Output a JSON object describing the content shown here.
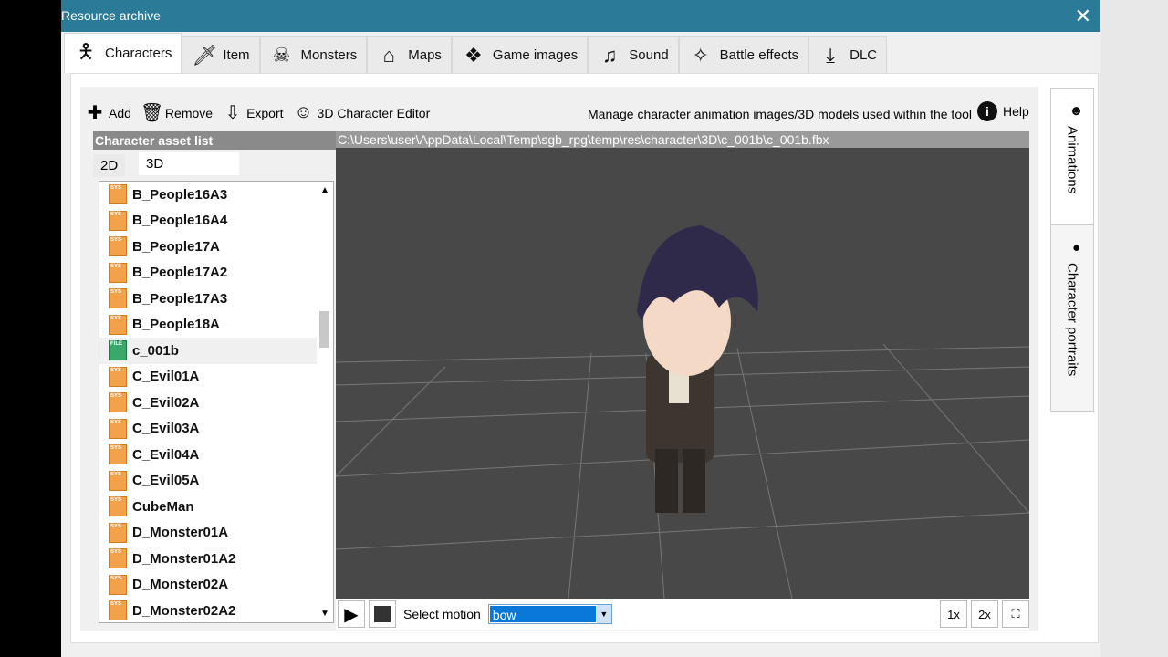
{
  "window": {
    "title": "Resource archive",
    "close": "✕"
  },
  "tabs": [
    {
      "label": "Characters",
      "icon": "person-icon",
      "glyph": "🯅"
    },
    {
      "label": "Item",
      "icon": "sword-icon",
      "glyph": "🗡"
    },
    {
      "label": "Monsters",
      "icon": "ghost-icon",
      "glyph": "☠"
    },
    {
      "label": "Maps",
      "icon": "house-icon",
      "glyph": "⌂"
    },
    {
      "label": "Game images",
      "icon": "box-icon",
      "glyph": "❖"
    },
    {
      "label": "Sound",
      "icon": "music-icon",
      "glyph": "♫"
    },
    {
      "label": "Battle effects",
      "icon": "sparkle-icon",
      "glyph": "✧"
    },
    {
      "label": "DLC",
      "icon": "download-icon",
      "glyph": "⤓"
    }
  ],
  "toolbar": {
    "add": "Add",
    "remove": "Remove",
    "export": "Export",
    "editor": "3D Character Editor",
    "description": "Manage character animation images/3D models used within the tool",
    "help": "Help"
  },
  "list": {
    "header": "Character asset list",
    "tab2d": "2D",
    "tab3d": "3D",
    "items": [
      {
        "name": "B_People16A3",
        "type": "SYS"
      },
      {
        "name": "B_People16A4",
        "type": "SYS"
      },
      {
        "name": "B_People17A",
        "type": "SYS"
      },
      {
        "name": "B_People17A2",
        "type": "SYS"
      },
      {
        "name": "B_People17A3",
        "type": "SYS"
      },
      {
        "name": "B_People18A",
        "type": "SYS"
      },
      {
        "name": "c_001b",
        "type": "FILE"
      },
      {
        "name": "C_Evil01A",
        "type": "SYS"
      },
      {
        "name": "C_Evil02A",
        "type": "SYS"
      },
      {
        "name": "C_Evil03A",
        "type": "SYS"
      },
      {
        "name": "C_Evil04A",
        "type": "SYS"
      },
      {
        "name": "C_Evil05A",
        "type": "SYS"
      },
      {
        "name": "CubeMan",
        "type": "SYS"
      },
      {
        "name": "D_Monster01A",
        "type": "SYS"
      },
      {
        "name": "D_Monster01A2",
        "type": "SYS"
      },
      {
        "name": "D_Monster02A",
        "type": "SYS"
      },
      {
        "name": "D_Monster02A2",
        "type": "SYS"
      }
    ]
  },
  "viewer": {
    "path": "C:\\Users\\user\\AppData\\Local\\Temp\\sgb_rpg\\temp\\res\\character\\3D\\c_001b\\c_001b.fbx",
    "motion_label": "Select motion",
    "motion_value": "bow",
    "x1": "1x",
    "x2": "2x"
  },
  "side_tabs": {
    "animations": "Animations",
    "portraits": "Character portraits"
  }
}
